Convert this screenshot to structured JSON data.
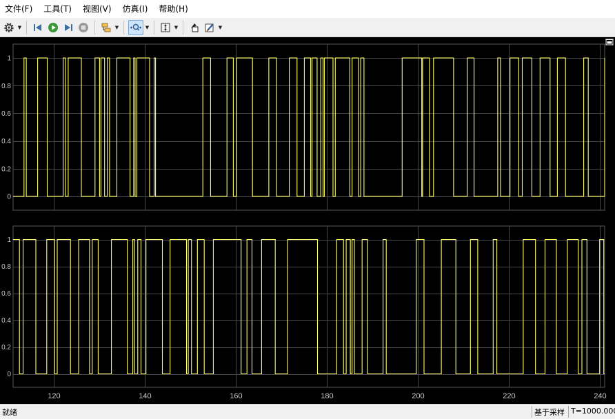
{
  "menu": {
    "items": [
      {
        "label": "文件(F)",
        "name": "menu-file"
      },
      {
        "label": "工具(T)",
        "name": "menu-tools"
      },
      {
        "label": "视图(V)",
        "name": "menu-view"
      },
      {
        "label": "仿真(I)",
        "name": "menu-simulation"
      },
      {
        "label": "帮助(H)",
        "name": "menu-help"
      }
    ]
  },
  "toolbar": {
    "icons": [
      "gear-icon",
      "step-back-icon",
      "run-icon",
      "step-forward-icon",
      "stop-icon",
      "signal-select-icon",
      "zoom-x-icon",
      "autoscale-icon",
      "highlight-block-icon",
      "style-icon"
    ]
  },
  "plot": {
    "background": "#000000",
    "grid_color": "#4a4a4a",
    "line_color": "#ffff66",
    "tick_color": "#c8c8c8"
  },
  "chart_data": [
    {
      "type": "line",
      "name": "top-axes",
      "xlim": [
        111,
        241
      ],
      "ylim": [
        -0.1,
        1.1
      ],
      "xticks": [
        120,
        140,
        160,
        180,
        200,
        220,
        240
      ],
      "yticks": [
        0,
        0.2,
        0.4,
        0.6,
        0.8,
        1
      ],
      "ytick_labels": [
        "0",
        "0.2",
        "0.4",
        "0.6",
        "0.8",
        "1"
      ],
      "grid": true,
      "initial": 0,
      "transitions": [
        113.4,
        113.9,
        116.4,
        118.5,
        122.0,
        122.5,
        123.1,
        126.0,
        129.0,
        130.0,
        130.3,
        131.1,
        131.7,
        132.2,
        133.8,
        136.7,
        137.5,
        137.8,
        138.2,
        141.0,
        142.0,
        142.3,
        152.7,
        154.4,
        158.0,
        159.4,
        160.1,
        163.6,
        167.2,
        168.9,
        171.7,
        173.4,
        175.0,
        176.4,
        176.7,
        177.8,
        178.6,
        179.1,
        179.4,
        181.3,
        181.8,
        185.0,
        185.5,
        186.9,
        187.4,
        188.1,
        196.5,
        200.8,
        201.0,
        202.5,
        203.4,
        207.8,
        210.8,
        212.3,
        217.5,
        218.1,
        220.2,
        222.1,
        222.9,
        225.0,
        226.8,
        229.0,
        230.6,
        232.4,
        236.4,
        237.4,
        241.0
      ]
    },
    {
      "type": "line",
      "name": "bottom-axes",
      "xlim": [
        111,
        241
      ],
      "ylim": [
        -0.1,
        1.1
      ],
      "xticks": [
        120,
        140,
        160,
        180,
        200,
        220,
        240
      ],
      "xtick_labels": [
        "120",
        "140",
        "160",
        "180",
        "200",
        "220",
        "240"
      ],
      "yticks": [
        0,
        0.2,
        0.4,
        0.6,
        0.8,
        1
      ],
      "ytick_labels": [
        "0",
        "0.2",
        "0.4",
        "0.6",
        "0.8",
        "1"
      ],
      "grid": true,
      "initial": 1,
      "transitions": [
        112.4,
        113.2,
        116.0,
        118.4,
        120.1,
        120.7,
        123.6,
        125.4,
        127.8,
        128.4,
        129.7,
        132.6,
        136.1,
        137.3,
        137.7,
        138.4,
        139.1,
        140.2,
        143.8,
        145.5,
        149.1,
        149.5,
        150.2,
        151.5,
        153.0,
        155.0,
        161.1,
        162.4,
        163.5,
        165.6,
        168.6,
        171.3,
        177.9,
        182.1,
        183.6,
        184.2,
        185.1,
        185.5,
        186.0,
        187.7,
        188.9,
        192.3,
        193.0,
        199.6,
        201.3,
        205.1,
        208.3,
        211.5,
        213.1,
        216.5,
        217.3,
        223.1,
        225.8,
        227.9,
        230.4,
        232.8,
        235.2,
        236.0,
        237.1,
        239.9,
        240.8
      ]
    }
  ],
  "status": {
    "ready": "就绪",
    "rate": "基于采样",
    "time": "T=1000.000"
  }
}
